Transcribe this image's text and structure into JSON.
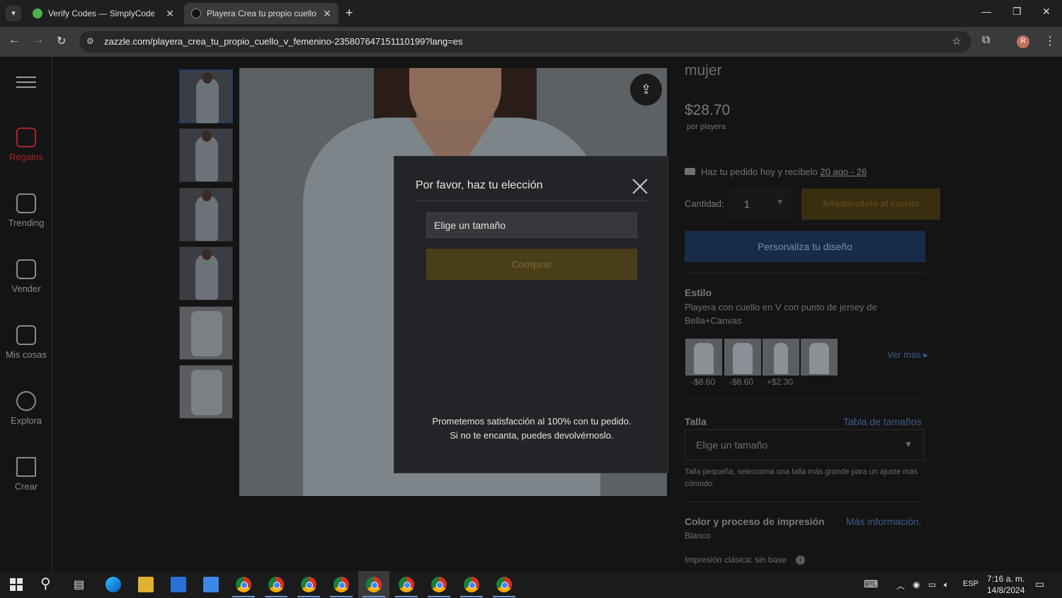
{
  "browser": {
    "tabs": [
      {
        "title": "Verify Codes — SimplyCodes",
        "active": false
      },
      {
        "title": "Playera Crea tu propio cuello-V",
        "active": true
      }
    ],
    "url": "zazzle.com/playera_crea_tu_propio_cuello_v_femenino-235807647151110199?lang=es",
    "profile_initial": "R"
  },
  "sidenav": {
    "items": [
      {
        "label": "Regalos",
        "active": true
      },
      {
        "label": "Trending"
      },
      {
        "label": "Vender"
      },
      {
        "label": "Mis cosas"
      },
      {
        "label": "Explora"
      },
      {
        "label": "Crear"
      }
    ]
  },
  "product": {
    "title_fragment": "mujer",
    "price": "$28.70",
    "per_unit": "por playera",
    "delivery_text": "Haz tu pedido hoy y recíbelo",
    "delivery_dates": "20 ago - 26",
    "qty_label": "Cantidad:",
    "qty_value": "1",
    "cart_button": "Añadiéndolo al carrito",
    "personalize_button": "Personaliza tu diseño",
    "style_heading": "Estilo",
    "style_desc": "Playera con cuello en V con punto de jersey de Bella+Canvas",
    "style_prices": [
      "-$8.60",
      "-$8.60",
      "+$2.30"
    ],
    "see_more": "Ver más",
    "size_heading": "Talla",
    "size_chart_link": "Tabla de tamaños",
    "size_select": "Elige un tamaño",
    "size_note": "Talla pequeña, selecciona una talla más grande para un ajuste más cómodo.",
    "color_heading": "Color y proceso de impresión",
    "color_more": "Más información.",
    "color_value": "Blanco",
    "print_label": "Impresión clásica: sin base"
  },
  "modal": {
    "title": "Por favor, haz tu elección",
    "size_placeholder": "Elige un tamaño",
    "buy_button": "Comprar",
    "guarantee_line1": "Prometemos satisfacción al 100% con tu pedido.",
    "guarantee_line2": "Si no te encanta, puedes devolvérnoslo."
  },
  "taskbar": {
    "lang": "ESP",
    "time": "7:16 a. m.",
    "date": "14/8/2024"
  }
}
